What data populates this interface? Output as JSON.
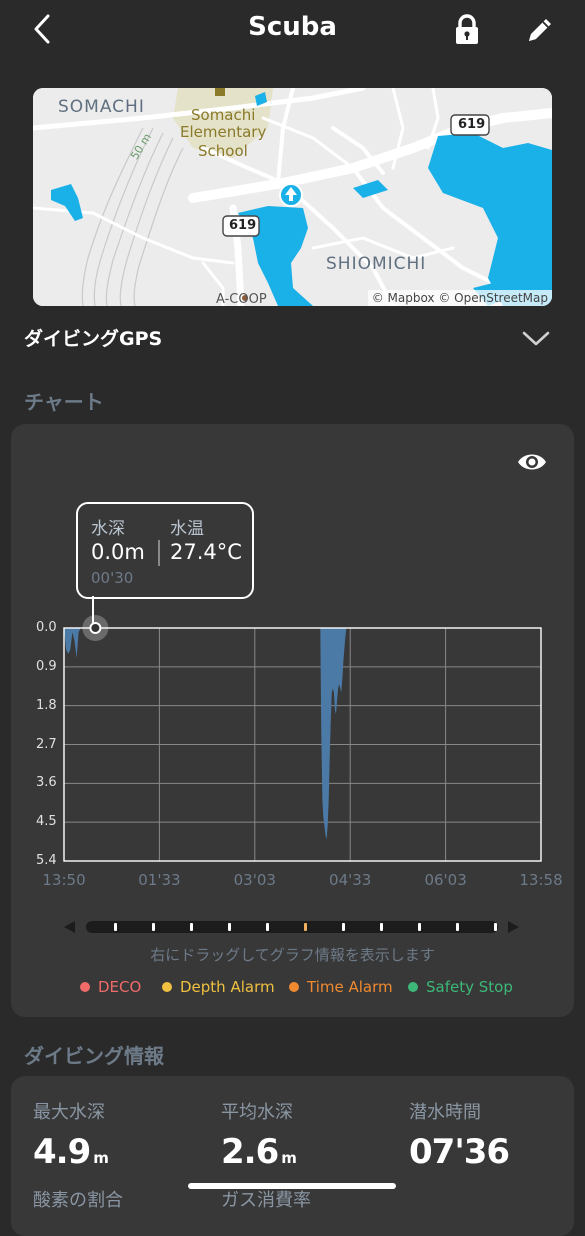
{
  "header": {
    "title": "Scuba"
  },
  "map": {
    "labels": {
      "somachi": "SOMACHI",
      "school_line1": "Somachi",
      "school_line2": "Elementary",
      "school_line3": "School",
      "contour": "50 m",
      "route_top": "619",
      "route_mid": "619",
      "shiomichi": "SHIOMICHI",
      "acoop": "A-COOP"
    },
    "attribution": "© Mapbox © OpenStreetMap",
    "colors": {
      "water": "#1ab0e8",
      "land": "#eeeeee",
      "road": "#ffffff",
      "park": "#d8d8a6"
    }
  },
  "gps_section": {
    "title": "ダイビングGPS"
  },
  "chart_section": {
    "title": "チャート"
  },
  "tooltip": {
    "depth_label": "水深",
    "temp_label": "水温",
    "depth_value": "0.0m",
    "temp_value": "27.4°C",
    "time": "00'30"
  },
  "chart_data": {
    "type": "area",
    "y_tick_labels": [
      "0.0",
      "0.9",
      "1.8",
      "2.7",
      "3.6",
      "4.5",
      "5.4"
    ],
    "x_tick_labels": [
      "13:50",
      "01'33",
      "03'03",
      "04'33",
      "06'03",
      "13:58"
    ],
    "ylim": [
      0,
      5.4
    ],
    "y_inverted": true,
    "xlim_seconds": [
      0,
      456
    ],
    "grid": true,
    "series": [
      {
        "points": [
          [
            0,
            0
          ],
          [
            2,
            0.5
          ],
          [
            4,
            0.6
          ],
          [
            6,
            0.5
          ],
          [
            8,
            0.1
          ],
          [
            10,
            0.3
          ],
          [
            12,
            0.7
          ],
          [
            14,
            0.1
          ],
          [
            16,
            0
          ],
          [
            245,
            0
          ],
          [
            246,
            2.5
          ],
          [
            247,
            4.0
          ],
          [
            248,
            4.4
          ],
          [
            249,
            4.6
          ],
          [
            250,
            4.8
          ],
          [
            251,
            4.9
          ],
          [
            252,
            4.6
          ],
          [
            253,
            4.0
          ],
          [
            254,
            3.0
          ],
          [
            255,
            2.2
          ],
          [
            256,
            1.5
          ],
          [
            257,
            1.4
          ],
          [
            258,
            1.5
          ],
          [
            259,
            1.9
          ],
          [
            260,
            2.0
          ],
          [
            261,
            1.7
          ],
          [
            262,
            1.4
          ],
          [
            263,
            1.3
          ],
          [
            264,
            1.4
          ],
          [
            265,
            1.5
          ],
          [
            266,
            1.2
          ],
          [
            267,
            0.8
          ],
          [
            268,
            0.5
          ],
          [
            269,
            0.2
          ],
          [
            270,
            0
          ]
        ]
      }
    ],
    "colors": {
      "fill": "#4c7aa6",
      "grid": "#888888",
      "axis": "#ffffff"
    },
    "cursor_seconds": 30
  },
  "scrubber": {
    "hint": "右にドラッグしてグラフ情報を表示します",
    "tick_count": 11,
    "active_tick": 5
  },
  "legend": [
    {
      "label": "DECO",
      "color": "#f06a6a"
    },
    {
      "label": "Depth Alarm",
      "color": "#f0c040"
    },
    {
      "label": "Time Alarm",
      "color": "#f08a30"
    },
    {
      "label": "Safety Stop",
      "color": "#3cb878"
    }
  ],
  "info_section": {
    "title": "ダイビング情報",
    "stats": [
      {
        "label": "最大水深",
        "value": "4.9",
        "unit": "m"
      },
      {
        "label": "平均水深",
        "value": "2.6",
        "unit": "m"
      },
      {
        "label": "潜水時間",
        "value": "07'36",
        "unit": ""
      }
    ],
    "row2_labels": [
      "酸素の割合",
      "ガス消費率"
    ]
  }
}
